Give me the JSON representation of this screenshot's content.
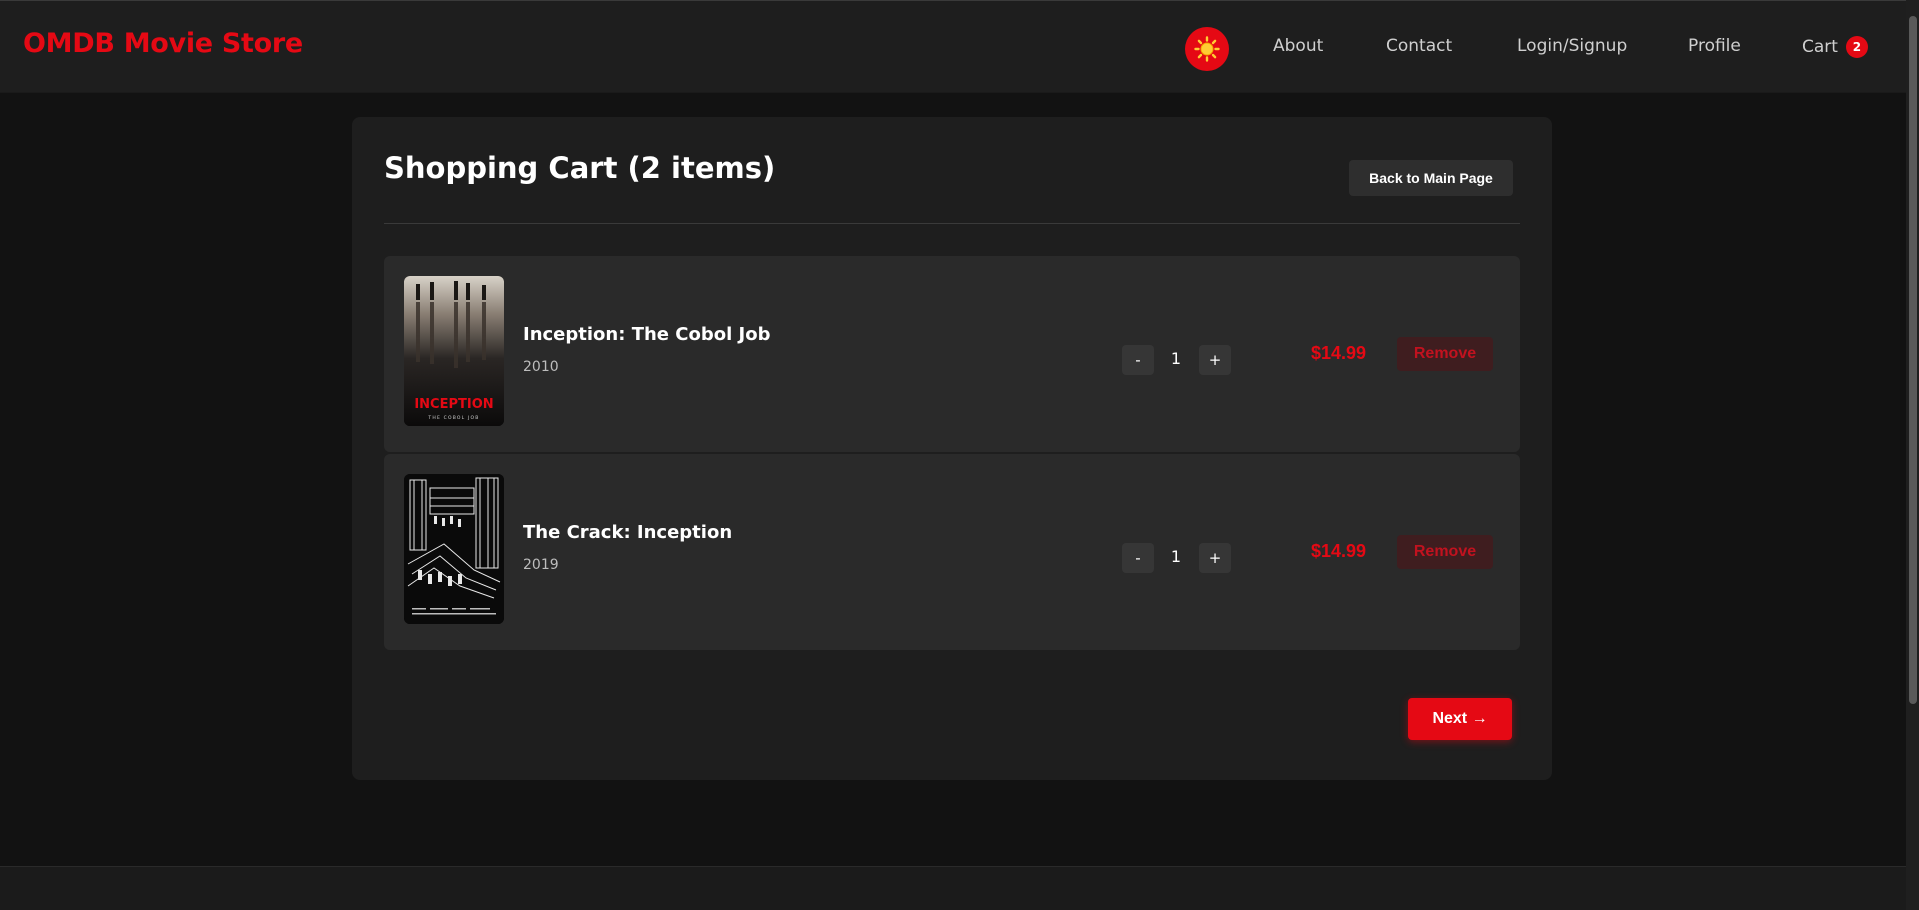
{
  "header": {
    "brand": "OMDB Movie Store",
    "theme_toggle_icon": "sun-icon",
    "nav": {
      "about": "About",
      "contact": "Contact",
      "login": "Login/Signup",
      "profile": "Profile",
      "cart": "Cart",
      "cart_count": "2"
    }
  },
  "cart": {
    "title": "Shopping Cart (2 items)",
    "back_label": "Back to Main Page",
    "items": [
      {
        "title": "Inception: The Cobol Job",
        "year": "2010",
        "quantity": "1",
        "price": "$14.99",
        "remove_label": "Remove",
        "decrement_label": "-",
        "increment_label": "+",
        "poster_text": "INCEPTION",
        "poster_subtext": "THE COBOL JOB"
      },
      {
        "title": "The Crack: Inception",
        "year": "2019",
        "quantity": "1",
        "price": "$14.99",
        "remove_label": "Remove",
        "decrement_label": "-",
        "increment_label": "+"
      }
    ],
    "next_label": "Next →"
  },
  "colors": {
    "accent": "#e50914",
    "background": "#121212",
    "panel": "#1e1e1e",
    "item": "#2a2a2a"
  }
}
